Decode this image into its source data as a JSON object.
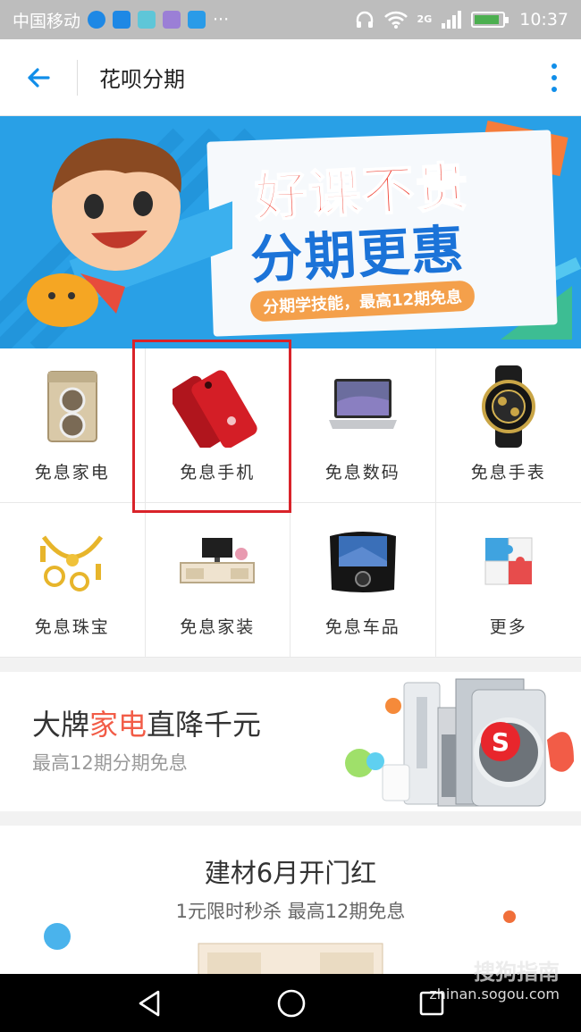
{
  "status_bar": {
    "carrier": "中国移动",
    "dots": "···",
    "network": "2G",
    "time": "10:37",
    "battery_level": 0.9
  },
  "header": {
    "title": "花呗分期"
  },
  "banner": {
    "headline_1": "好课不贵",
    "headline_2": "分期更惠",
    "subline": "分期学技能，最高12期免息"
  },
  "categories": [
    {
      "label": "免息家电"
    },
    {
      "label": "免息手机"
    },
    {
      "label": "免息数码"
    },
    {
      "label": "免息手表"
    },
    {
      "label": "免息珠宝"
    },
    {
      "label": "免息家装"
    },
    {
      "label": "免息车品"
    },
    {
      "label": "更多"
    }
  ],
  "promo_appliances": {
    "title_prefix": "大牌",
    "title_highlight": "家电",
    "title_suffix": "直降千元",
    "subtitle": "最高12期分期免息"
  },
  "promo_building": {
    "title": "建材6月开门红",
    "subtitle": "1元限时秒杀 最高12期免息"
  },
  "watermark": {
    "logo": "搜狗指南",
    "url": "zhinan.sogou.com"
  },
  "colors": {
    "accent": "#108ee9",
    "highlight_red": "#d9232a",
    "promo_orange": "#f25c47"
  }
}
